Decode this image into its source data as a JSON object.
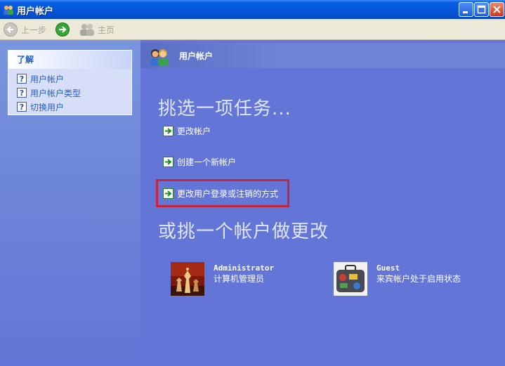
{
  "window": {
    "title": "用户帐户"
  },
  "toolbar": {
    "back_label": "上一步",
    "home_label": "主页"
  },
  "sidebar": {
    "box_title": "了解",
    "items": [
      {
        "label": "用户帐户"
      },
      {
        "label": "用户帐户类型"
      },
      {
        "label": "切换用户"
      }
    ]
  },
  "main": {
    "header_title": "用户帐户",
    "heading_tasks": "挑选一项任务...",
    "tasks": [
      {
        "label": "更改帐户"
      },
      {
        "label": "创建一个新帐户"
      },
      {
        "label": "更改用户登录或注销的方式"
      }
    ],
    "heading_accounts": "或挑一个帐户做更改",
    "accounts": [
      {
        "name": "Administrator",
        "description": "计算机管理员"
      },
      {
        "name": "Guest",
        "description": "来宾帐户处于启用状态"
      }
    ]
  },
  "colors": {
    "titlebar": "#0755d9",
    "pane": "#6375d6",
    "highlight": "#c4253a",
    "task_arrow": "#2e9a2e"
  }
}
